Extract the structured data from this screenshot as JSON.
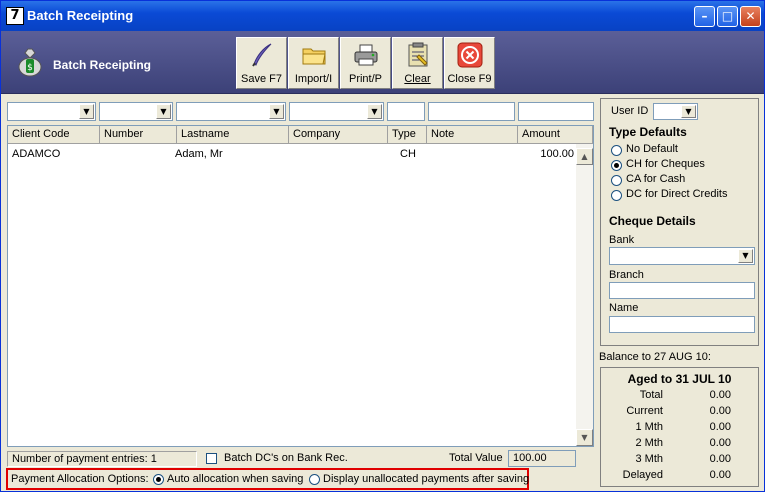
{
  "window": {
    "title": "Batch Receipting",
    "icon_glyph": "7"
  },
  "toolbar": {
    "heading": "Batch Receipting",
    "buttons": [
      {
        "label": "Save F7",
        "icon": "quill-icon"
      },
      {
        "label": "Import/I",
        "icon": "folder-icon"
      },
      {
        "label": "Print/P",
        "icon": "printer-icon"
      },
      {
        "label": "Clear",
        "icon": "clipboard-icon"
      },
      {
        "label": "Close F9",
        "icon": "close-circle-icon"
      }
    ]
  },
  "grid": {
    "columns": [
      "Client Code",
      "Number",
      "Lastname",
      "Company",
      "Type",
      "Note",
      "Amount"
    ],
    "rows": [
      {
        "client_code": "ADAMCO",
        "number": "",
        "lastname": "Adam, Mr",
        "company": "",
        "type": "CH",
        "note": "",
        "amount": "100.00"
      }
    ]
  },
  "status": {
    "entries_label": "Number of payment entries: 1",
    "batch_dc_label": "Batch DC's on Bank Rec.",
    "total_label": "Total Value",
    "total_value": "100.00"
  },
  "allocation": {
    "label": "Payment Allocation Options:",
    "options": [
      "Auto allocation when saving",
      "Display unallocated payments after saving"
    ],
    "selected": 0
  },
  "side": {
    "user_id_label": "User ID",
    "type_defaults_heading": "Type Defaults",
    "type_defaults": [
      "No Default",
      "CH for Cheques",
      "CA for Cash",
      "DC for Direct Credits"
    ],
    "type_selected": 1,
    "cheque_heading": "Cheque Details",
    "bank_label": "Bank",
    "branch_label": "Branch",
    "name_label": "Name",
    "balance_label": "Balance to 27 AUG 10:"
  },
  "aged": {
    "heading": "Aged to 31 JUL 10",
    "rows": [
      {
        "label": "Total",
        "value": "0.00"
      },
      {
        "label": "Current",
        "value": "0.00"
      },
      {
        "label": "1 Mth",
        "value": "0.00"
      },
      {
        "label": "2 Mth",
        "value": "0.00"
      },
      {
        "label": "3 Mth",
        "value": "0.00"
      },
      {
        "label": "Delayed",
        "value": "0.00"
      }
    ]
  },
  "colors": {
    "title_bar": "#0a4ad6",
    "toolbar_bg": "#4a4f88",
    "highlight_border": "#e00000"
  }
}
